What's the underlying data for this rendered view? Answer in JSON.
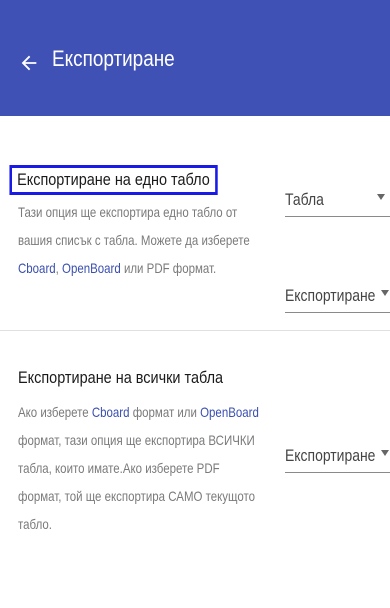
{
  "header": {
    "title": "Експортиране"
  },
  "single_board": {
    "title": "Експортиране на едно табло",
    "desc_line1": "Тази опция ще експортира едно табло от",
    "desc_line2": "вашия списък с табла. Можете да изберете",
    "desc_link_cboard": "Cboard",
    "desc_comma": ", ",
    "desc_link_openboard": "OpenBoard",
    "desc_tail": " или PDF формат.",
    "board_select_value": "Табла",
    "format_select_value": "Експортиране"
  },
  "all_boards": {
    "title": "Експортиране на всички табла",
    "desc_pre": "Ако изберете ",
    "desc_link_cboard": "Cboard",
    "desc_mid": " формат или ",
    "desc_link_openboard": "OpenBoard",
    "desc_line2": "формат, тази опция ще експортира ВСИЧКИ",
    "desc_line3": "табла, които имате.Ако изберете PDF",
    "desc_line4": "формат, той ще експортира САМО текущото",
    "desc_line5": "табло.",
    "format_select_value": "Експортиране"
  },
  "colors": {
    "appbar": "#3f51b5",
    "link": "#3a4fb0",
    "highlight_outline": "#1a1ae6"
  },
  "icons": {
    "back": "arrow-left-icon",
    "dropdown": "caret-down-icon"
  }
}
